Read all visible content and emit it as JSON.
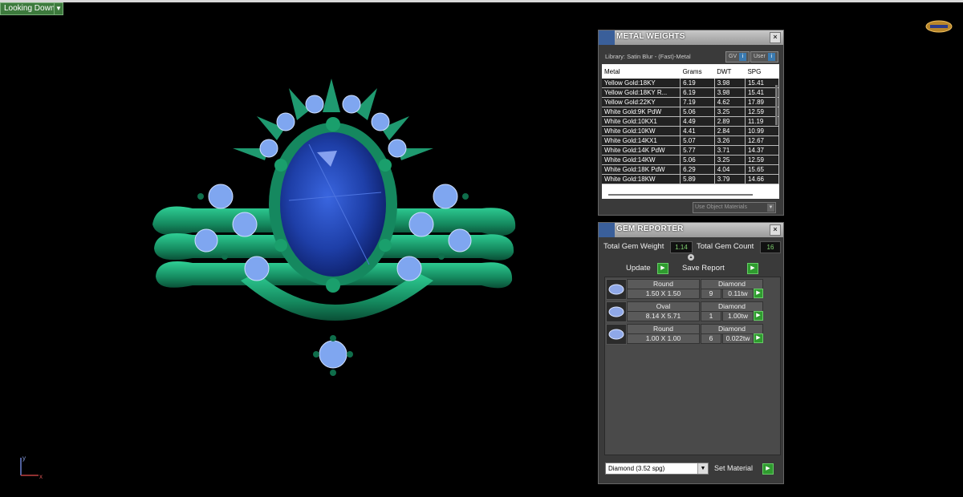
{
  "viewport": {
    "view_label": "Looking Down",
    "axis_y": "y",
    "axis_x": "x"
  },
  "metal_weights": {
    "title": "METAL WEIGHTS",
    "library": "Library: Satin Blur - (Fast)-Metal",
    "gv_label": "GV",
    "user_label": "User",
    "info_glyph": "i",
    "columns": [
      "Metal",
      "Grams",
      "DWT",
      "SPG"
    ],
    "rows": [
      [
        "Yellow Gold:18KY",
        "6.19",
        "3.98",
        "15.41"
      ],
      [
        "Yellow Gold:18KY R...",
        "6.19",
        "3.98",
        "15.41"
      ],
      [
        "Yellow Gold:22KY",
        "7.19",
        "4.62",
        "17.89"
      ],
      [
        "White Gold:9K PdW",
        "5.06",
        "3.25",
        "12.59"
      ],
      [
        "White Gold:10KX1",
        "4.49",
        "2.89",
        "11.19"
      ],
      [
        "White Gold:10KW",
        "4.41",
        "2.84",
        "10.99"
      ],
      [
        "White Gold:14KX1",
        "5.07",
        "3.26",
        "12.67"
      ],
      [
        "White Gold:14K PdW",
        "5.77",
        "3.71",
        "14.37"
      ],
      [
        "White Gold:14KW",
        "5.06",
        "3.25",
        "12.59"
      ],
      [
        "White Gold:18K PdW",
        "6.29",
        "4.04",
        "15.65"
      ],
      [
        "White Gold:18KW",
        "5.89",
        "3.79",
        "14.66"
      ]
    ],
    "use_object_materials": "Use Object Materials"
  },
  "gem_reporter": {
    "title": "GEM REPORTER",
    "total_weight_label": "Total Gem Weight",
    "total_weight_value": "1.14",
    "total_count_label": "Total Gem Count",
    "total_count_value": "16",
    "update_label": "Update",
    "save_report_label": "Save Report",
    "gems": [
      {
        "shape": "Round",
        "size": "1.50 X 1.50",
        "material": "Diamond",
        "count": "9",
        "weight": "0.11tw"
      },
      {
        "shape": "Oval",
        "size": "8.14 X 5.71",
        "material": "Diamond",
        "count": "1",
        "weight": "1.00tw"
      },
      {
        "shape": "Round",
        "size": "1.00 X 1.00",
        "material": "Diamond",
        "count": "6",
        "weight": "0.022tw"
      }
    ],
    "material_select": "Diamond     (3.52 spg)",
    "set_material_label": "Set Material"
  },
  "icons": {
    "go": "▶",
    "dropdown": "▼",
    "close": "×",
    "up": "▲"
  },
  "colors": {
    "metal": "#1f9a70",
    "center_stone": "#1e3fa8",
    "accent_stones": "#7fa6f0",
    "go_button": "#2f9b2f"
  }
}
